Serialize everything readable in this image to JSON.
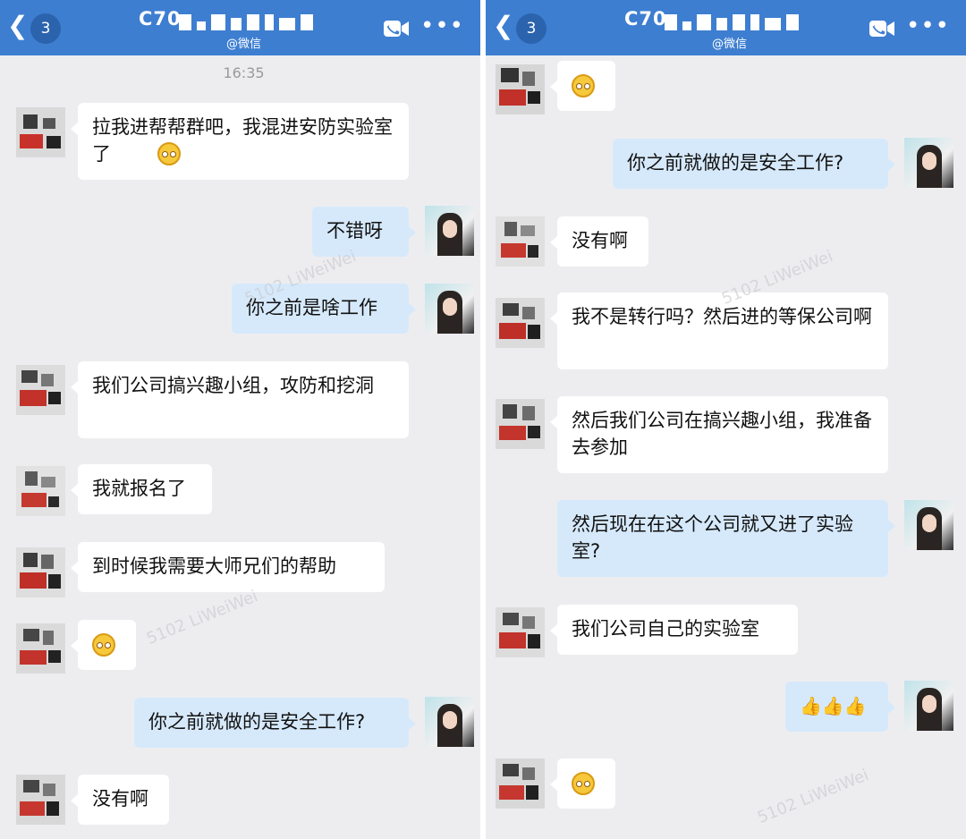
{
  "left": {
    "header": {
      "badge": "3",
      "title": "C70",
      "subtitle": "@微信"
    },
    "time": "16:35",
    "messages": [
      {
        "side": "in",
        "text": "拉我进帮帮群吧，我混进安防实验室了",
        "emoji": true
      },
      {
        "side": "out",
        "text": "不错呀"
      },
      {
        "side": "out",
        "text": "你之前是啥工作"
      },
      {
        "side": "in",
        "text": "我们公司搞兴趣小组，攻防和挖洞"
      },
      {
        "side": "in",
        "text": "我就报名了"
      },
      {
        "side": "in",
        "text": "到时候我需要大师兄们的帮助"
      },
      {
        "side": "in",
        "text": "",
        "emoji": true
      },
      {
        "side": "out",
        "text": "你之前就做的是安全工作?"
      },
      {
        "side": "in",
        "text": "没有啊"
      }
    ]
  },
  "right": {
    "header": {
      "badge": "3",
      "title": "C70",
      "subtitle": "@微信"
    },
    "messages": [
      {
        "side": "in",
        "text": "",
        "emoji": true
      },
      {
        "side": "out",
        "text": "你之前就做的是安全工作?"
      },
      {
        "side": "in",
        "text": "没有啊"
      },
      {
        "side": "in",
        "text": "我不是转行吗？然后进的等保公司啊"
      },
      {
        "side": "in",
        "text": "然后我们公司在搞兴趣小组，我准备去参加"
      },
      {
        "side": "out",
        "text": "然后现在在这个公司就又进了实验室?"
      },
      {
        "side": "in",
        "text": "我们公司自己的实验室"
      },
      {
        "side": "out",
        "text": "👍👍👍"
      },
      {
        "side": "in",
        "text": "",
        "emoji": true
      }
    ]
  },
  "watermark": "5102 LiWeiWei",
  "colors": {
    "header": "#3d7ed1",
    "bg": "#ededf0",
    "out_bubble": "#d6e9fb",
    "in_bubble": "#ffffff"
  }
}
